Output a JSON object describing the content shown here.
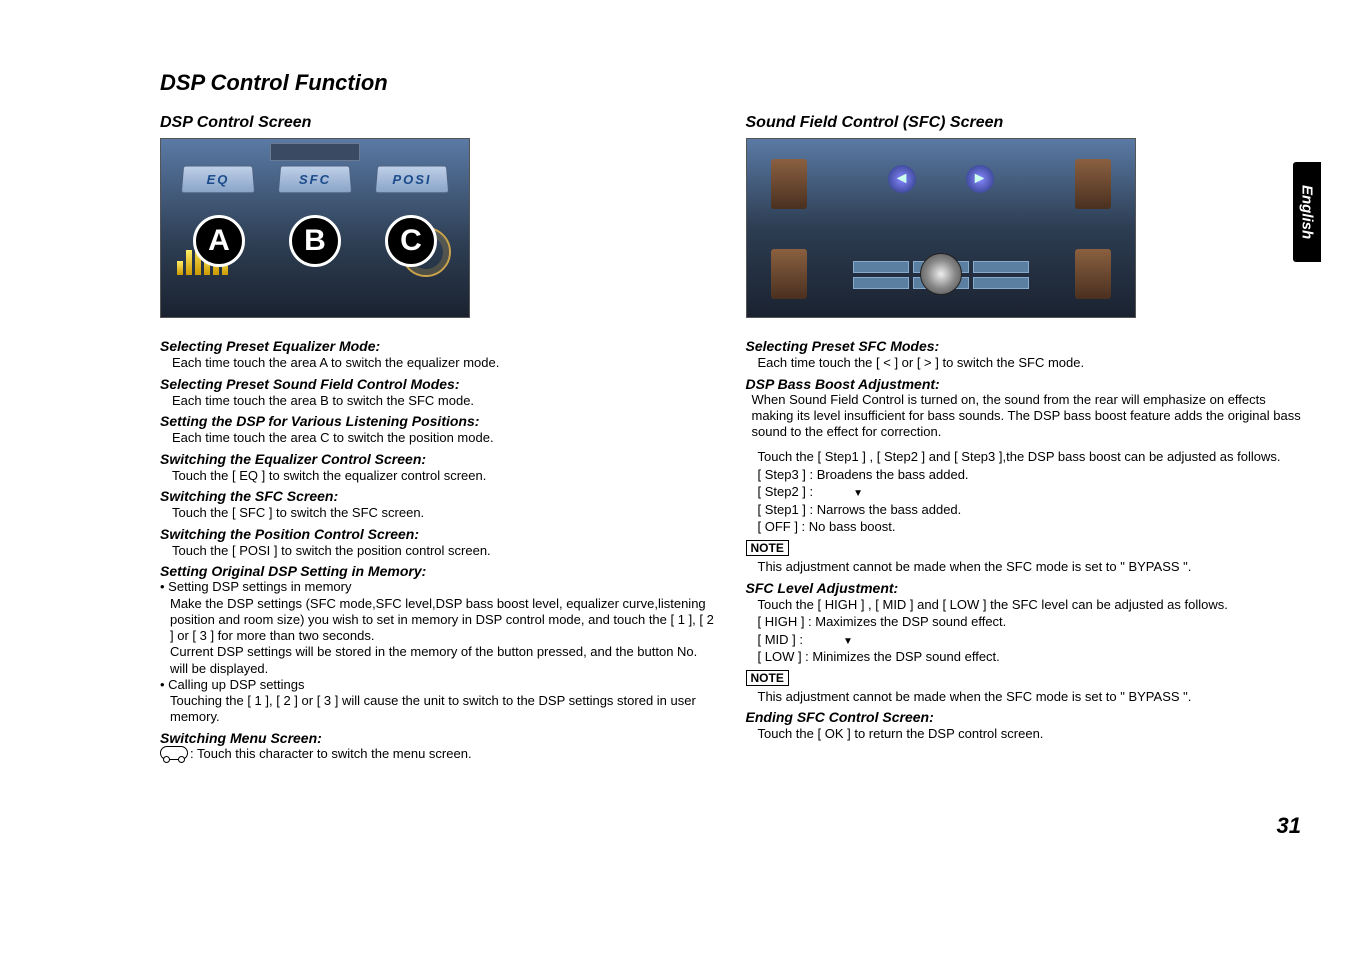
{
  "page_title": "DSP Control Function",
  "page_number": "31",
  "side_tab": "English",
  "left": {
    "section_title": "DSP Control Screen",
    "screenshot": {
      "tab_eq": "EQ",
      "tab_sfc": "SFC",
      "tab_posi": "POSI",
      "letters": [
        "A",
        "B",
        "C"
      ]
    },
    "items": [
      {
        "head": "Selecting Preset Equalizer Mode:",
        "body": "Each time touch the area A to switch the equalizer mode."
      },
      {
        "head": "Selecting Preset Sound Field Control Modes:",
        "body": "Each time touch the area B to switch the SFC mode."
      },
      {
        "head": "Setting the DSP for Various Listening Positions:",
        "body": "Each time touch the area C to switch the position mode."
      },
      {
        "head": "Switching the Equalizer Control Screen:",
        "body": "Touch the [ EQ ] to switch the equalizer control screen."
      },
      {
        "head": "Switching the SFC Screen:",
        "body": "Touch the [ SFC ] to switch the SFC screen."
      },
      {
        "head": "Switching the Position Control Screen:",
        "body": "Touch the [ POSI ] to switch the position control screen."
      }
    ],
    "memory_head": "Setting Original DSP Setting in Memory:",
    "memory_b1_title": "Setting DSP settings in memory",
    "memory_b1_body": "Make the DSP settings (SFC mode,SFC level,DSP bass boost level, equalizer curve,listening position and room size)  you wish to set in memory in DSP control mode, and touch the [ 1 ], [ 2 ] or [ 3 ] for more than two seconds.\nCurrent DSP settings will be stored in the memory of the button pressed, and the button No. will be displayed.",
    "memory_b2_title": "Calling up DSP settings",
    "memory_b2_body": "Touching the [ 1 ], [ 2 ] or [ 3 ] will cause the unit to switch to the DSP settings stored in user memory.",
    "switch_menu_head": "Switching Menu Screen:",
    "switch_menu_body": ": Touch this character to switch the menu screen."
  },
  "right": {
    "section_title": "Sound Field Control (SFC) Screen",
    "sfc_head": "Selecting Preset SFC Modes:",
    "sfc_body": "Each time touch the [ < ] or  [ > ] to switch the SFC mode.",
    "bass_head": "DSP Bass Boost Adjustment:",
    "bass_intro": "When Sound Field Control is turned on, the sound from the rear will emphasize on effects making its level insufficient for bass sounds. The DSP bass boost feature adds the original bass sound to the effect for correction.",
    "bass_body1": "Touch the [ Step1 ] , [ Step2 ] and [ Step3 ],the DSP bass boost can be adjusted as follows.",
    "bass_l1": "[ Step3 ] : Broadens the bass added.",
    "bass_l2": "[ Step2 ] :",
    "bass_l3": "[ Step1 ] : Narrows the bass added.",
    "bass_l4": "[ OFF ]    : No bass boost.",
    "note_label": "NOTE",
    "note1_body": "This adjustment cannot be made when the SFC mode is set to \" BYPASS \".",
    "sfclvl_head": "SFC Level Adjustment:",
    "sfclvl_body1": "Touch the [ HIGH ] , [ MID ] and [ LOW ] the SFC level can be adjusted as follows.",
    "sfclvl_l1": "[ HIGH ] : Maximizes the DSP sound effect.",
    "sfclvl_l2": "[ MID ]   :",
    "sfclvl_l3": "[ LOW ]  : Minimizes the DSP sound effect.",
    "note2_body": "This adjustment cannot be made when the SFC mode is set to \" BYPASS \".",
    "end_head": "Ending SFC Control Screen:",
    "end_body": "Touch the [ OK ] to return the DSP control screen."
  }
}
